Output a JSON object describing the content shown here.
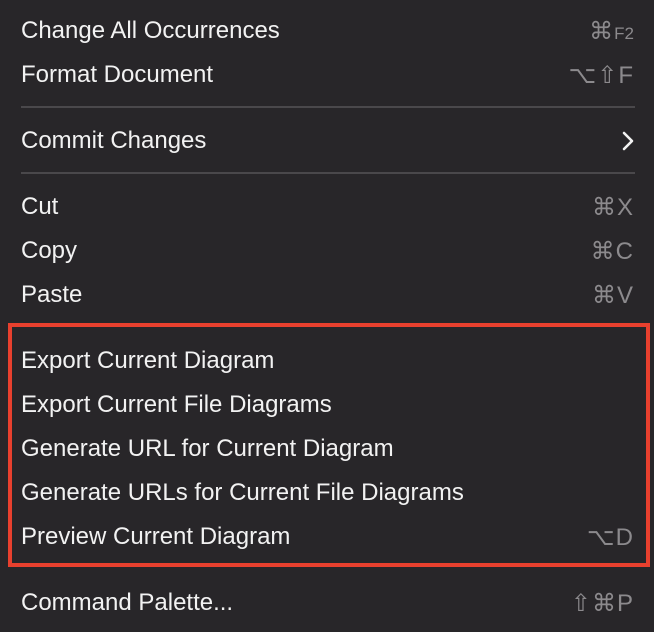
{
  "menu": {
    "items": [
      {
        "label": "Change All Occurrences",
        "shortcut_prefix": "⌘",
        "shortcut_key": "F2"
      },
      {
        "label": "Format Document",
        "shortcut": "⌥⇧F"
      },
      {
        "label": "Commit Changes",
        "submenu_icon": "chevron-right-icon"
      },
      {
        "label": "Cut",
        "shortcut": "⌘X"
      },
      {
        "label": "Copy",
        "shortcut": "⌘C"
      },
      {
        "label": "Paste",
        "shortcut": "⌘V"
      },
      {
        "label": "Export Current Diagram"
      },
      {
        "label": "Export Current File Diagrams"
      },
      {
        "label": "Generate URL for Current Diagram"
      },
      {
        "label": "Generate URLs for Current File Diagrams"
      },
      {
        "label": "Preview Current Diagram",
        "shortcut": "⌥D"
      },
      {
        "label": "Command Palette...",
        "shortcut": "⇧⌘P"
      }
    ]
  },
  "colors": {
    "background": "#282629",
    "text": "#f2f2f2",
    "shortcut_text": "#8c8a8d",
    "separator": "#4a484b",
    "highlight_border": "#e8402e"
  }
}
